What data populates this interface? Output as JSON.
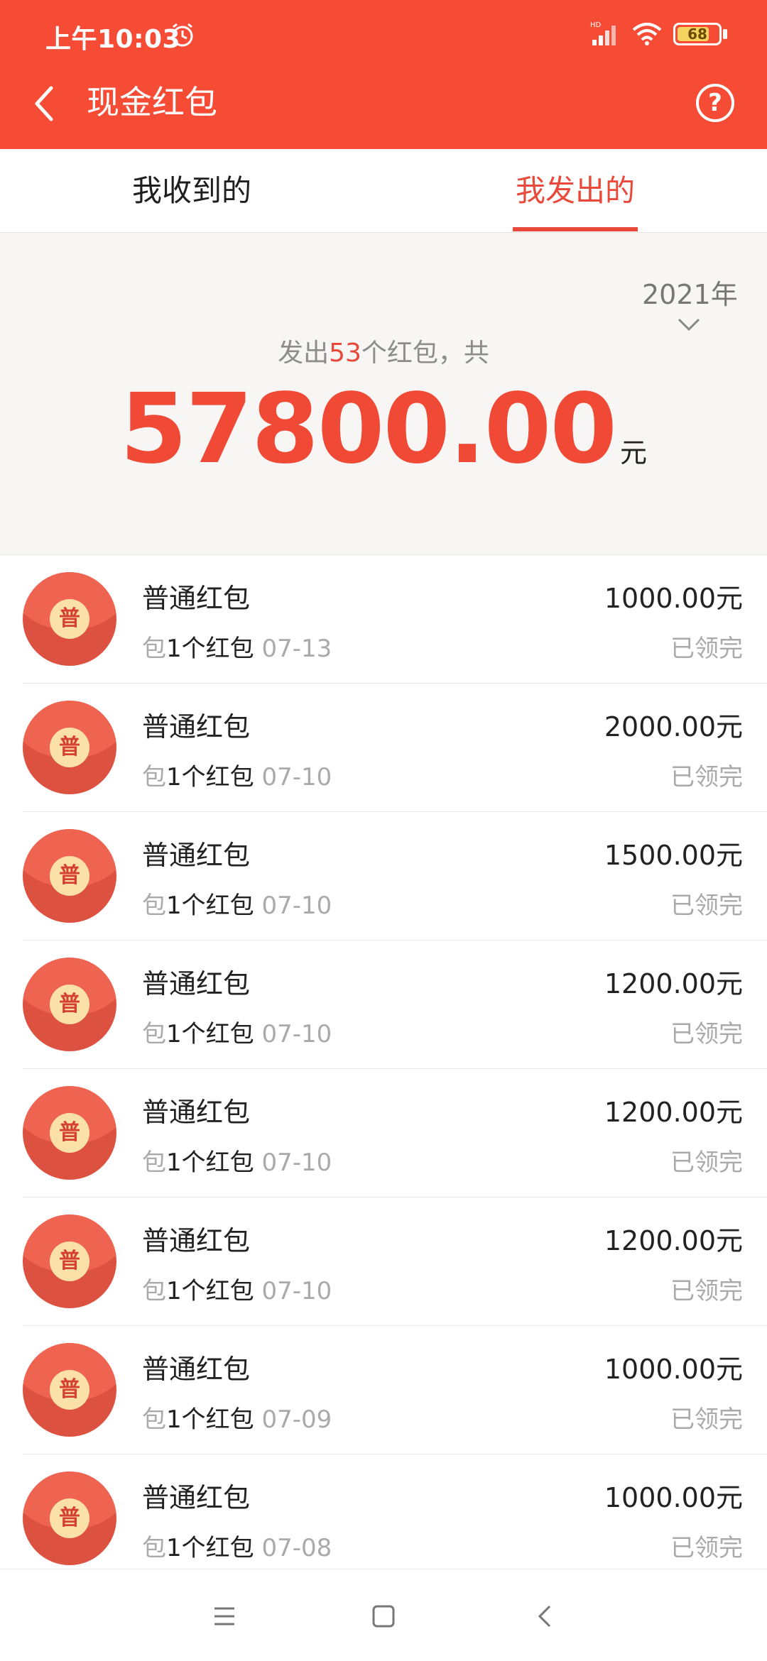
{
  "status_bar": {
    "time": "上午10:03",
    "battery": "68"
  },
  "header": {
    "title": "现金红包"
  },
  "tabs": [
    {
      "label": "我收到的",
      "active": false
    },
    {
      "label": "我发出的",
      "active": true
    }
  ],
  "summary": {
    "year": "2021年",
    "count_prefix": "发出",
    "count": "53",
    "count_suffix": "个红包，共",
    "total": "57800.00",
    "unit": "元"
  },
  "list": [
    {
      "title": "普通红包",
      "sub_prefix": "包",
      "sub_count": "1个红包",
      "date": "07-13",
      "amount": "1000.00元",
      "status": "已领完",
      "badge": "普"
    },
    {
      "title": "普通红包",
      "sub_prefix": "包",
      "sub_count": "1个红包",
      "date": "07-10",
      "amount": "2000.00元",
      "status": "已领完",
      "badge": "普"
    },
    {
      "title": "普通红包",
      "sub_prefix": "包",
      "sub_count": "1个红包",
      "date": "07-10",
      "amount": "1500.00元",
      "status": "已领完",
      "badge": "普"
    },
    {
      "title": "普通红包",
      "sub_prefix": "包",
      "sub_count": "1个红包",
      "date": "07-10",
      "amount": "1200.00元",
      "status": "已领完",
      "badge": "普"
    },
    {
      "title": "普通红包",
      "sub_prefix": "包",
      "sub_count": "1个红包",
      "date": "07-10",
      "amount": "1200.00元",
      "status": "已领完",
      "badge": "普"
    },
    {
      "title": "普通红包",
      "sub_prefix": "包",
      "sub_count": "1个红包",
      "date": "07-10",
      "amount": "1200.00元",
      "status": "已领完",
      "badge": "普"
    },
    {
      "title": "普通红包",
      "sub_prefix": "包",
      "sub_count": "1个红包",
      "date": "07-09",
      "amount": "1000.00元",
      "status": "已领完",
      "badge": "普"
    },
    {
      "title": "普通红包",
      "sub_prefix": "包",
      "sub_count": "1个红包",
      "date": "07-08",
      "amount": "1000.00元",
      "status": "已领完",
      "badge": "普"
    }
  ],
  "colors": {
    "brand": "#f64c36",
    "accent": "#e8493a"
  },
  "icons": {
    "back": "back-arrow-icon",
    "help": "help-circle-icon",
    "year_dropdown": "chevron-down-icon",
    "nav_menu": "menu-icon",
    "nav_home": "home-square-icon",
    "nav_back": "nav-back-icon"
  }
}
